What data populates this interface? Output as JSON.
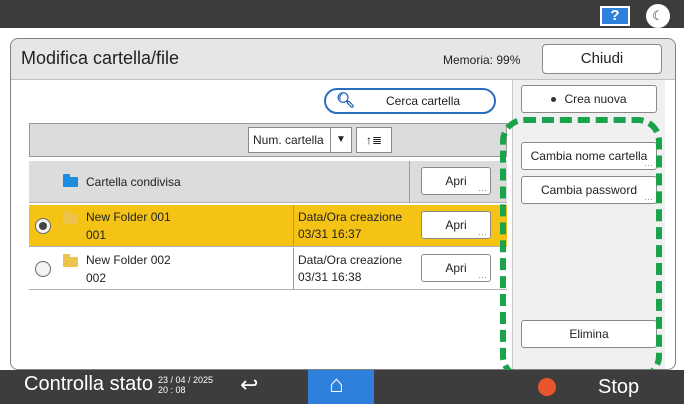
{
  "topbar": {
    "help_label": "?",
    "theme_icon": "☾"
  },
  "dialog": {
    "title": "Modifica cartella/file",
    "memory_label": "Memoria: 99%",
    "close_label": "Chiudi"
  },
  "search": {
    "icon": "magnifier-icon",
    "label": "Cerca cartella"
  },
  "sort": {
    "selected": "Num. cartella",
    "order_label": "↑≣"
  },
  "folders": {
    "shared": {
      "name": "Cartella condivisa",
      "open_label": "Apri"
    },
    "items": [
      {
        "name": "New Folder 001",
        "number": "001",
        "date_label": "Data/Ora creazione",
        "date_value": "03/31 16:37",
        "open_label": "Apri",
        "selected": true
      },
      {
        "name": "New Folder 002",
        "number": "002",
        "date_label": "Data/Ora creazione",
        "date_value": "03/31 16:38",
        "open_label": "Apri",
        "selected": false
      }
    ]
  },
  "actions": {
    "create_new": "Crea nuova",
    "rename_folder": "Cambia nome cartella",
    "change_password": "Cambia password",
    "delete": "Elimina"
  },
  "bottombar": {
    "status_label": "Controlla stato",
    "date": "23 / 04 / 2025",
    "time": "20 : 08",
    "back_icon": "↩",
    "home_icon": "⌂",
    "stop_label": "Stop"
  },
  "colors": {
    "selected_row": "#f5c316",
    "accent_blue": "#2f7fdc",
    "highlight_green": "#1aa34a",
    "shared_folder_icon": "#1a8de0",
    "folder_icon": "#ecc44d"
  }
}
